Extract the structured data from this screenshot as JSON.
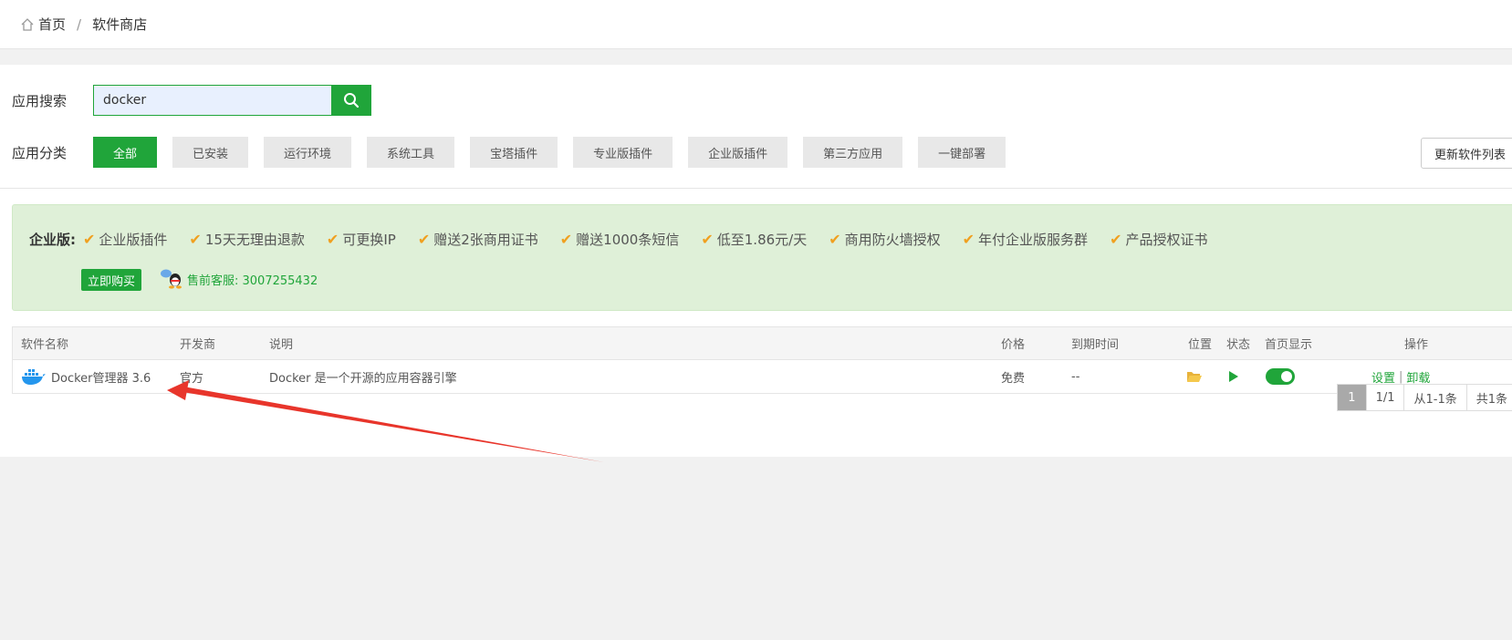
{
  "breadcrumb": {
    "home": "首页",
    "separator": "/",
    "current": "软件商店"
  },
  "search": {
    "label": "应用搜索",
    "value": "docker"
  },
  "category": {
    "label": "应用分类",
    "items": [
      "全部",
      "已安装",
      "运行环境",
      "系统工具",
      "宝塔插件",
      "专业版插件",
      "企业版插件",
      "第三方应用",
      "一键部署"
    ],
    "active_index": 0,
    "update_button": "更新软件列表"
  },
  "promo": {
    "title": "企业版:",
    "perks": [
      "企业版插件",
      "15天无理由退款",
      "可更换IP",
      "赠送2张商用证书",
      "赠送1000条短信",
      "低至1.86元/天",
      "商用防火墙授权",
      "年付企业版服务群",
      "产品授权证书"
    ],
    "buy_button": "立即购买",
    "support": "售前客服: 3007255432"
  },
  "table": {
    "headers": {
      "name": "软件名称",
      "developer": "开发商",
      "description": "说明",
      "price": "价格",
      "expire": "到期时间",
      "location": "位置",
      "status": "状态",
      "homepage": "首页显示",
      "actions": "操作"
    },
    "rows": [
      {
        "name": "Docker管理器 3.6",
        "developer": "官方",
        "description": "Docker 是一个开源的应用容器引擎",
        "price": "免费",
        "expire": "--",
        "homepage_enabled": true,
        "action_settings": "设置",
        "action_separator": "|",
        "action_uninstall": "卸载"
      }
    ]
  },
  "pagination": {
    "current": "1",
    "pages": "1/1",
    "range": "从1-1条",
    "total": "共1条"
  },
  "colors": {
    "accent": "#20a53a",
    "promo_bg": "#dff0d8",
    "annotation_arrow": "#e8352b",
    "check": "#f0a020"
  }
}
